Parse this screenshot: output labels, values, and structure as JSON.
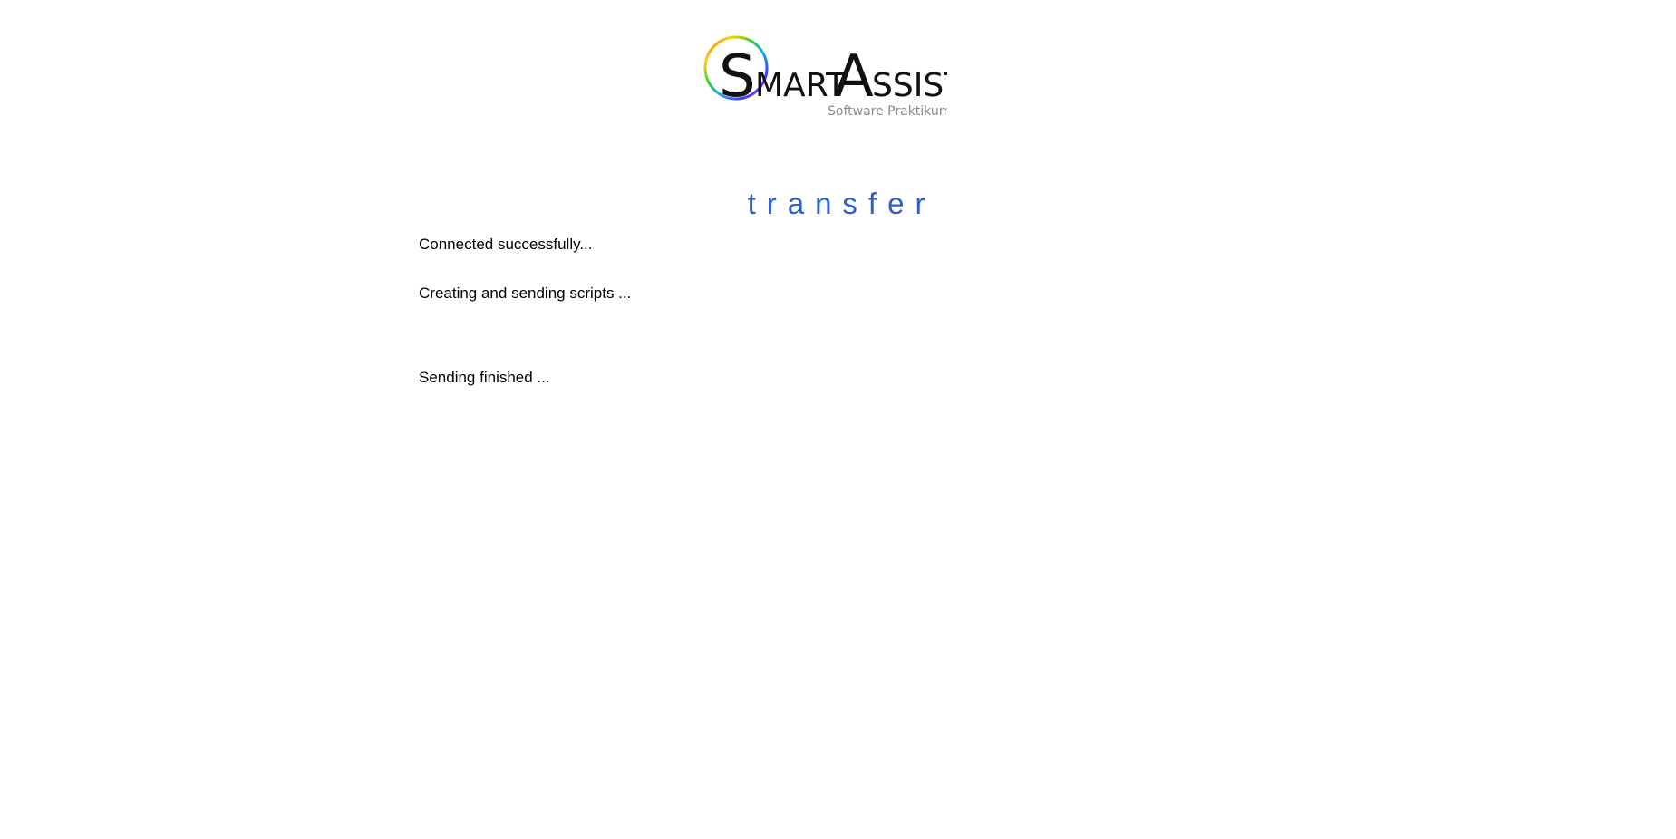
{
  "logo": {
    "name_s": "S",
    "name_mart": "MART",
    "name_a": "A",
    "name_ssist": "SSIST",
    "subtitle": "Software Praktikum",
    "ring_colors": [
      "#ff2a2a",
      "#ffd400",
      "#2bd42b",
      "#1aa8ff",
      "#3a3aff",
      "#e21ee2"
    ]
  },
  "page": {
    "title": "transfer"
  },
  "status": {
    "connected": "Connected successfully...",
    "creating": "Creating and sending scripts ...",
    "finished": "Sending finished ..."
  },
  "colors": {
    "title": "#2e5dcc",
    "text": "#000000",
    "background": "#ffffff"
  }
}
